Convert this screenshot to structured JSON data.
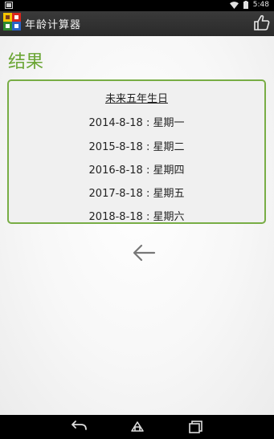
{
  "status_bar": {
    "time": "5:48"
  },
  "action_bar": {
    "title": "年龄计算器"
  },
  "result": {
    "heading": "结果",
    "card_title": "未来五年生日",
    "rows": [
      "2014-8-18 : 星期一",
      "2015-8-18 : 星期二",
      "2016-8-18 : 星期四",
      "2017-8-18 : 星期五",
      "2018-8-18 : 星期六"
    ]
  },
  "colors": {
    "accent": "#6aa534",
    "card_border": "#78ad45",
    "action_bar": "#333333"
  }
}
